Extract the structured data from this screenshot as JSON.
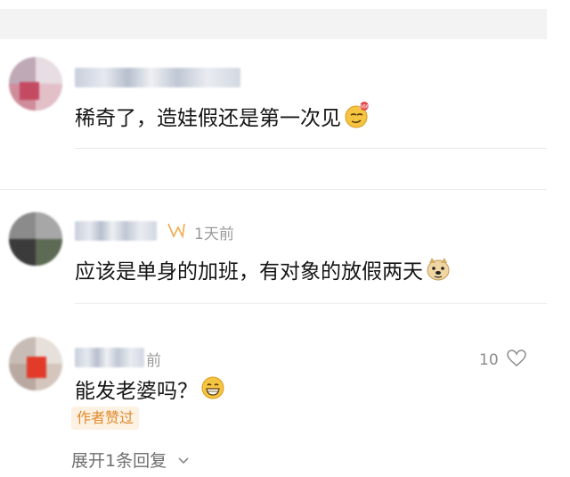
{
  "comments": [
    {
      "text": "稀奇了，造娃假还是第一次见",
      "emoji": "smirk-666-emoji"
    },
    {
      "time": "1天前",
      "text": "应该是单身的加班，有对象的放假两天",
      "emoji": "doge-emoji"
    },
    {
      "time_fragment": "前",
      "likes": "10",
      "text": "能发老婆吗？",
      "emoji": "grin-emoji",
      "badge": "作者赞过",
      "expand_label": "展开1条回复"
    }
  ],
  "colors": {
    "badge_text": "#e08a2a",
    "badge_bg": "#fdf1e3",
    "meta": "#9a9a9a"
  }
}
